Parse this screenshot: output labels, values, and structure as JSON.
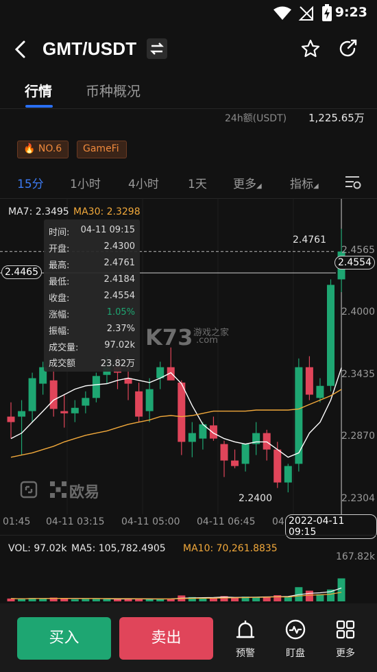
{
  "status_bar": {
    "time": "9:23"
  },
  "header": {
    "title": "GMT/USDT"
  },
  "tabs": [
    {
      "label": "行情"
    },
    {
      "label": "币种概况"
    }
  ],
  "stats": {
    "volume_label": "24h额(USDT)",
    "volume_value": "1,225.65万"
  },
  "badges": [
    {
      "label": "NO.6"
    },
    {
      "label": "GameFi"
    }
  ],
  "interval_tabs": [
    {
      "label": "15分"
    },
    {
      "label": "1小时"
    },
    {
      "label": "4小时"
    },
    {
      "label": "1天"
    },
    {
      "label": "更多"
    },
    {
      "label": "指标"
    }
  ],
  "ma_legend": {
    "ma7": "MA7: 2.3495",
    "ma30": "MA30: 2.3298"
  },
  "tooltip": [
    {
      "key": "时间:",
      "value": "04-11 09:15"
    },
    {
      "key": "开盘:",
      "value": "2.4300"
    },
    {
      "key": "最高:",
      "value": "2.4761"
    },
    {
      "key": "最低:",
      "value": "2.4184"
    },
    {
      "key": "收盘:",
      "value": "2.4554"
    },
    {
      "key": "涨幅:",
      "value": "1.05%"
    },
    {
      "key": "振幅:",
      "value": "2.37%"
    },
    {
      "key": "成交量:",
      "value": "97.02k"
    },
    {
      "key": "成交额",
      "value": "23.82万"
    }
  ],
  "price_axis": [
    "2.4565",
    "2.4000",
    "2.3435",
    "2.2870",
    "2.2304"
  ],
  "price_tags": {
    "left": "2.4465",
    "right": "2.4554"
  },
  "annotations": {
    "high": "2.4761",
    "low": "2.2400"
  },
  "time_axis": [
    "01:45",
    "04-11 03:15",
    "04-11 05:00",
    "04-11 06:45",
    "04",
    "2022-04-11 09:15"
  ],
  "watermarks": {
    "k73": "K73",
    "k73_sub": "游戏之家",
    "k73_dom": ".com",
    "okx": "欧易"
  },
  "volume_legend": {
    "vol": "VOL: 97.02k",
    "ma5": "MA5: 105,782.4905",
    "ma10": "MA10: 70,261.8835",
    "axis_max": "167.82k"
  },
  "bottom": {
    "buy": "买入",
    "sell": "卖出",
    "nav": [
      {
        "label": "预警"
      },
      {
        "label": "盯盘"
      },
      {
        "label": "更多"
      }
    ]
  },
  "colors": {
    "up": "#1ea672",
    "down": "#e0455a",
    "ma7": "#ffffff",
    "ma30": "#f2a93b",
    "accent": "#2a6ff2"
  },
  "chart_data": {
    "type": "candlestick",
    "pair": "GMT/USDT",
    "interval": "15分",
    "candles": [
      {
        "o": 2.305,
        "h": 2.318,
        "l": 2.285,
        "c": 2.3
      },
      {
        "o": 2.305,
        "h": 2.32,
        "l": 2.27,
        "c": 2.31
      },
      {
        "o": 2.31,
        "h": 2.345,
        "l": 2.3,
        "c": 2.34
      },
      {
        "o": 2.335,
        "h": 2.355,
        "l": 2.325,
        "c": 2.35
      },
      {
        "o": 2.338,
        "h": 2.35,
        "l": 2.305,
        "c": 2.312
      },
      {
        "o": 2.31,
        "h": 2.325,
        "l": 2.295,
        "c": 2.308
      },
      {
        "o": 2.308,
        "h": 2.32,
        "l": 2.3,
        "c": 2.313
      },
      {
        "o": 2.315,
        "h": 2.328,
        "l": 2.308,
        "c": 2.322
      },
      {
        "o": 2.322,
        "h": 2.345,
        "l": 2.318,
        "c": 2.342
      },
      {
        "o": 2.343,
        "h": 2.36,
        "l": 2.335,
        "c": 2.35
      },
      {
        "o": 2.35,
        "h": 2.36,
        "l": 2.33,
        "c": 2.345
      },
      {
        "o": 2.34,
        "h": 2.35,
        "l": 2.32,
        "c": 2.335
      },
      {
        "o": 2.328,
        "h": 2.336,
        "l": 2.3,
        "c": 2.305
      },
      {
        "o": 2.31,
        "h": 2.34,
        "l": 2.3,
        "c": 2.33
      },
      {
        "o": 2.34,
        "h": 2.355,
        "l": 2.33,
        "c": 2.35
      },
      {
        "o": 2.35,
        "h": 2.368,
        "l": 2.342,
        "c": 2.338
      },
      {
        "o": 2.336,
        "h": 2.338,
        "l": 2.27,
        "c": 2.282
      },
      {
        "o": 2.282,
        "h": 2.3,
        "l": 2.268,
        "c": 2.29
      },
      {
        "o": 2.285,
        "h": 2.3,
        "l": 2.275,
        "c": 2.298
      },
      {
        "o": 2.297,
        "h": 2.305,
        "l": 2.283,
        "c": 2.285
      },
      {
        "o": 2.28,
        "h": 2.283,
        "l": 2.25,
        "c": 2.265
      },
      {
        "o": 2.265,
        "h": 2.275,
        "l": 2.258,
        "c": 2.26
      },
      {
        "o": 2.262,
        "h": 2.275,
        "l": 2.255,
        "c": 2.28
      },
      {
        "o": 2.28,
        "h": 2.3,
        "l": 2.27,
        "c": 2.29
      },
      {
        "o": 2.29,
        "h": 2.293,
        "l": 2.265,
        "c": 2.275
      },
      {
        "o": 2.275,
        "h": 2.282,
        "l": 2.24,
        "c": 2.245
      },
      {
        "o": 2.245,
        "h": 2.262,
        "l": 2.236,
        "c": 2.26
      },
      {
        "o": 2.262,
        "h": 2.358,
        "l": 2.255,
        "c": 2.35
      },
      {
        "o": 2.35,
        "h": 2.36,
        "l": 2.32,
        "c": 2.325
      },
      {
        "o": 2.322,
        "h": 2.34,
        "l": 2.318,
        "c": 2.333
      },
      {
        "o": 2.333,
        "h": 2.43,
        "l": 2.328,
        "c": 2.425
      },
      {
        "o": 2.43,
        "h": 2.4761,
        "l": 2.4184,
        "c": 2.4554
      }
    ],
    "ma7": [
      2.285,
      2.29,
      2.3,
      2.31,
      2.32,
      2.325,
      2.33,
      2.333,
      2.334,
      2.335,
      2.338,
      2.34,
      2.338,
      2.336,
      2.34,
      2.345,
      2.335,
      2.315,
      2.298,
      2.29,
      2.285,
      2.282,
      2.28,
      2.282,
      2.282,
      2.275,
      2.268,
      2.272,
      2.29,
      2.3,
      2.32,
      2.3495
    ],
    "ma30": [
      2.268,
      2.27,
      2.272,
      2.275,
      2.278,
      2.282,
      2.285,
      2.288,
      2.29,
      2.292,
      2.295,
      2.298,
      2.3,
      2.302,
      2.305,
      2.306,
      2.305,
      2.306,
      2.308,
      2.31,
      2.31,
      2.31,
      2.31,
      2.311,
      2.311,
      2.311,
      2.311,
      2.312,
      2.316,
      2.32,
      2.324,
      2.3298
    ],
    "volume": [
      12,
      10,
      14,
      11,
      16,
      13,
      9,
      10,
      12,
      11,
      9,
      10,
      12,
      9,
      10,
      11,
      25,
      18,
      14,
      14,
      22,
      16,
      20,
      18,
      18,
      26,
      20,
      60,
      45,
      30,
      50,
      97.02
    ]
  }
}
